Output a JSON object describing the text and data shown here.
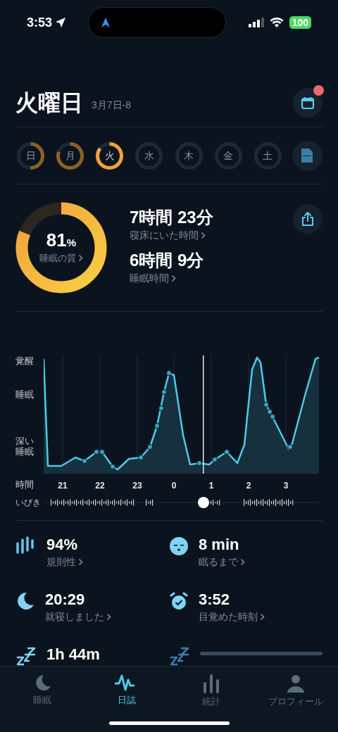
{
  "status_bar": {
    "time": "3:53",
    "battery": "100"
  },
  "header": {
    "title": "火曜日",
    "date_range": "3月7日-8",
    "calendar_badge": true
  },
  "days": [
    {
      "label": "日",
      "level": 0.5,
      "selected": false
    },
    {
      "label": "月",
      "level": 0.8,
      "selected": false
    },
    {
      "label": "火",
      "level": 0.85,
      "selected": true
    },
    {
      "label": "水",
      "selected": false
    },
    {
      "label": "木",
      "selected": false
    },
    {
      "label": "金",
      "selected": false
    },
    {
      "label": "土",
      "selected": false
    }
  ],
  "summary": {
    "quality": {
      "value": "81",
      "unit": "%",
      "label": "睡眠の質",
      "level": 0.81
    },
    "stats": [
      {
        "value": "7時間 23分",
        "label": "寝床にいた時間"
      },
      {
        "value": "6時間 9分",
        "label": "睡眠時間"
      }
    ]
  },
  "sleep_graph": {
    "y_labels": [
      "覚醒",
      "睡眠",
      "深い睡眠"
    ],
    "x_label": "時間",
    "x_ticks": [
      "21",
      "22",
      "23",
      "0",
      "1",
      "2",
      "3"
    ],
    "snore_label": "いびき"
  },
  "metrics": [
    {
      "kind": "regularity",
      "value": "94%",
      "label": "規則性"
    },
    {
      "kind": "fall_asleep",
      "value": "8 min",
      "label": "眠るまで"
    },
    {
      "kind": "bedtime",
      "value": "20:29",
      "label": "就寝しました"
    },
    {
      "kind": "wakeup",
      "value": "3:52",
      "label": "目覚めた時刻"
    },
    {
      "kind": "deep",
      "value": "1h 44m"
    },
    {
      "kind": "loading"
    }
  ],
  "tabs": [
    {
      "kind": "sleep",
      "label": "睡眠",
      "selected": false
    },
    {
      "kind": "journal",
      "label": "日誌",
      "selected": true
    },
    {
      "kind": "stats",
      "label": "統計",
      "selected": false
    },
    {
      "kind": "profile",
      "label": "プロフィール",
      "selected": false
    }
  ]
}
